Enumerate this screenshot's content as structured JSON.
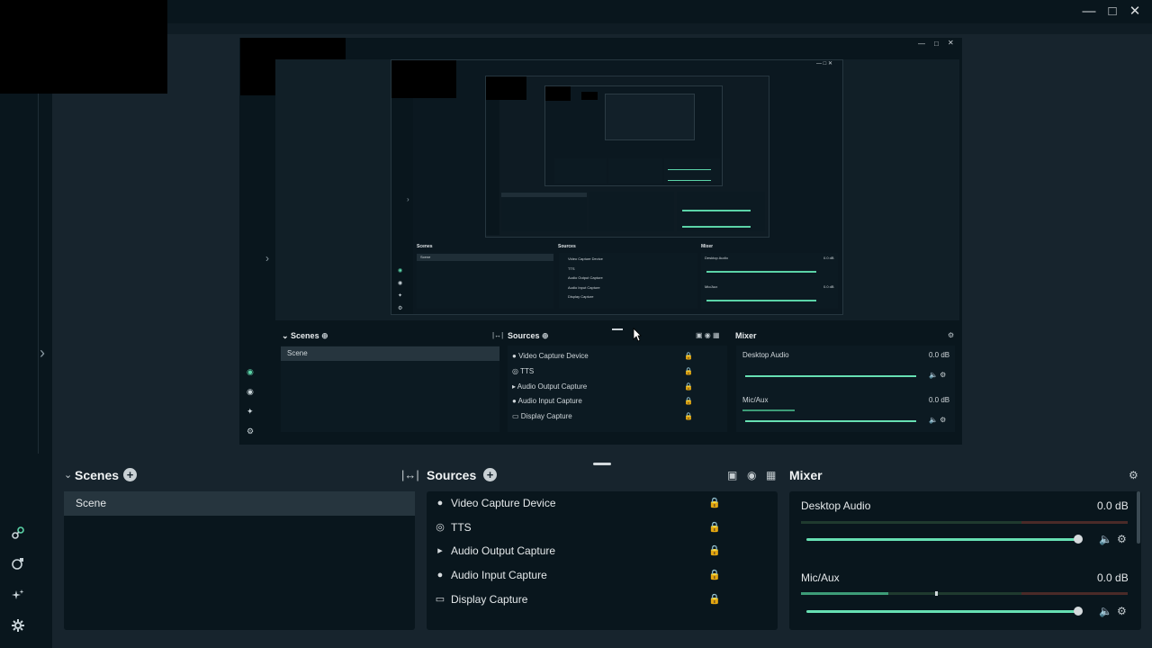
{
  "window": {
    "minimize_icon": "minimize-icon",
    "maximize_icon": "maximize-icon",
    "close_icon": "close-icon"
  },
  "colors": {
    "accent": "#67e0b3",
    "background": "#17242d",
    "panel": "#09161d"
  },
  "preview": {
    "scenes_title": "Scenes",
    "sources_title": "Sources",
    "mixer_title": "Mixer",
    "scene_item": "Scene",
    "sources": [
      {
        "label": "Video Capture Device",
        "icon": "webcam-icon"
      },
      {
        "label": "TTS",
        "icon": "globe-icon"
      },
      {
        "label": "Audio Output Capture",
        "icon": "speaker-icon"
      },
      {
        "label": "Audio Input Capture",
        "icon": "microphone-icon"
      },
      {
        "label": "Display Capture",
        "icon": "monitor-icon"
      }
    ],
    "mixer": [
      {
        "name": "Desktop Audio",
        "level": "0.0 dB"
      },
      {
        "name": "Mic/Aux",
        "level": "0.0 dB"
      }
    ]
  },
  "dock": {
    "scenes": {
      "title": "Scenes",
      "items": [
        "Scene"
      ]
    },
    "sources": {
      "title": "Sources",
      "items": [
        {
          "label": "Video Capture Device",
          "icon": "webcam-icon"
        },
        {
          "label": "TTS",
          "icon": "globe-icon"
        },
        {
          "label": "Audio Output Capture",
          "icon": "speaker-icon"
        },
        {
          "label": "Audio Input Capture",
          "icon": "microphone-icon"
        },
        {
          "label": "Display Capture",
          "icon": "monitor-icon"
        }
      ]
    },
    "mixer": {
      "title": "Mixer",
      "channels": [
        {
          "name": "Desktop Audio",
          "level": "0.0 dB",
          "volume": 1.0
        },
        {
          "name": "Mic/Aux",
          "level": "0.0 dB",
          "volume": 1.0
        }
      ]
    }
  },
  "leftnav": {
    "icons": [
      "studio-mode-icon",
      "layout-editor-icon",
      "ai-highlighter-icon",
      "settings-icon"
    ]
  }
}
